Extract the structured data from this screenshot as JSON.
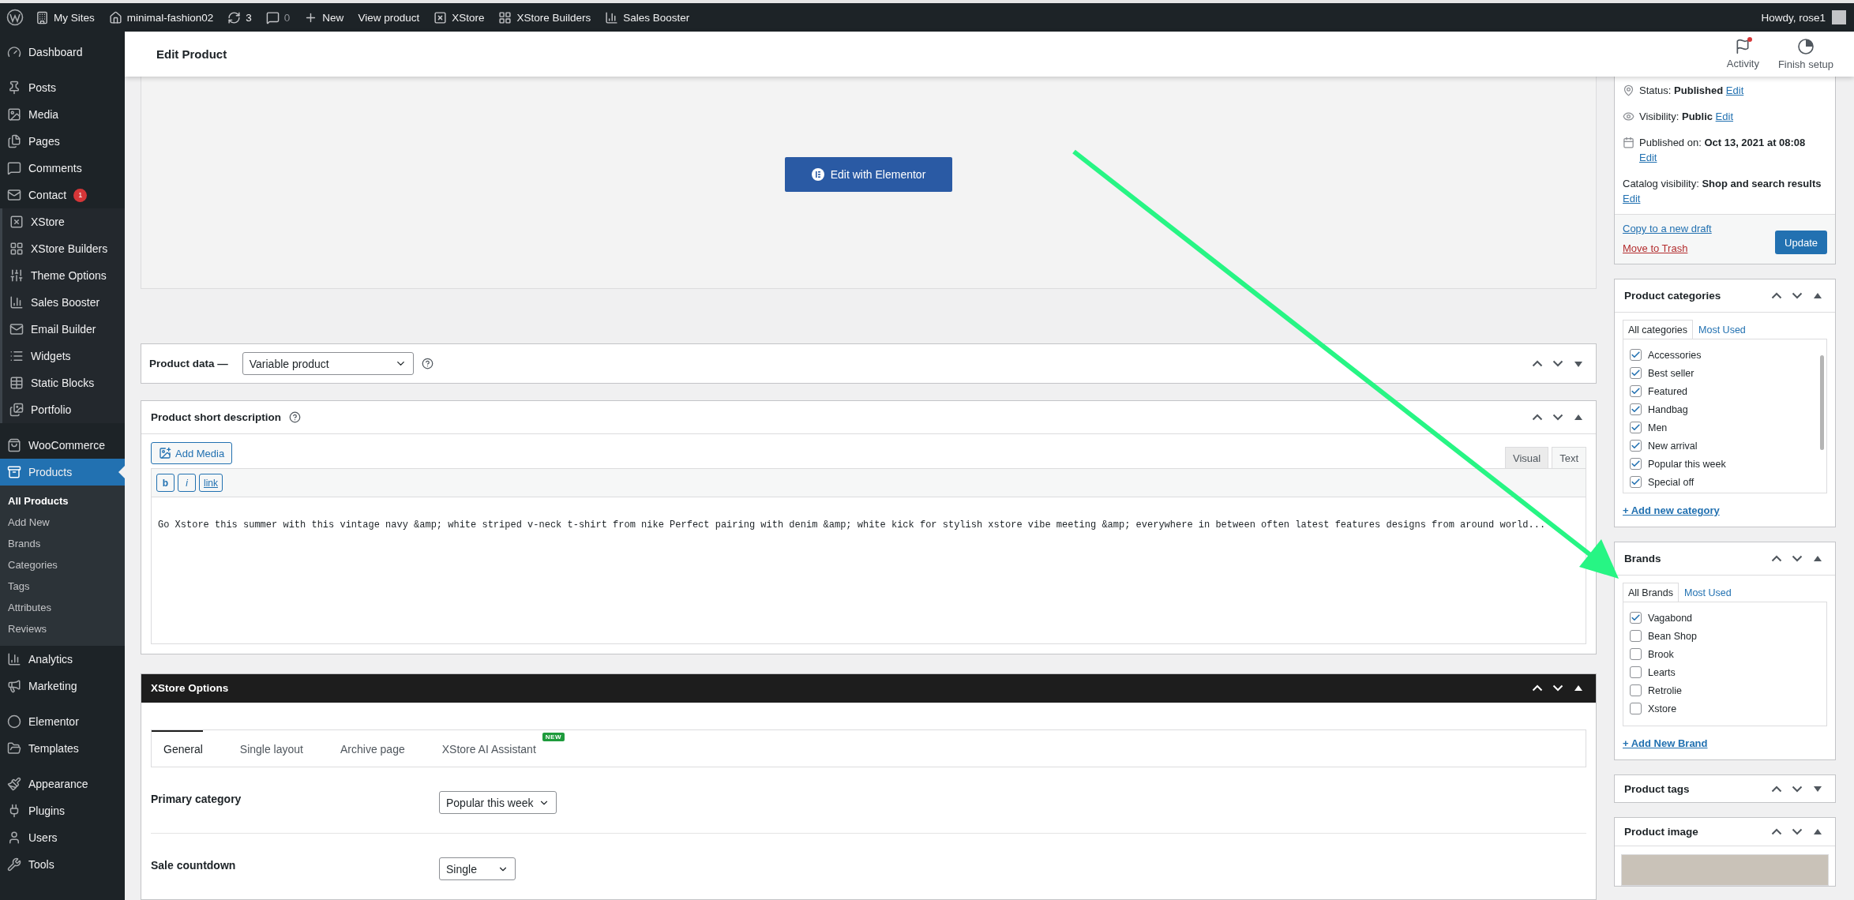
{
  "admin_bar": {
    "items": [
      "My Sites",
      "minimal-fashion02",
      "3",
      "0",
      "New",
      "View product",
      "XStore",
      "XStore Builders",
      "Sales Booster"
    ],
    "greeting": "Howdy, rose1"
  },
  "sidebar": {
    "sections": [
      {
        "kind": "plain",
        "items": [
          {
            "label": "Dashboard",
            "selected": false
          }
        ]
      },
      {
        "kind": "plain",
        "items": [
          {
            "label": "Posts",
            "selected": false
          },
          {
            "label": "Media",
            "selected": false
          },
          {
            "label": "Pages",
            "selected": false
          },
          {
            "label": "Comments",
            "selected": false
          },
          {
            "label": "Contact",
            "selected": false,
            "badge": "1"
          }
        ]
      },
      {
        "kind": "theme",
        "items": [
          {
            "label": "XStore",
            "selected": false
          },
          {
            "label": "XStore Builders",
            "selected": false
          },
          {
            "label": "Theme Options",
            "selected": false
          },
          {
            "label": "Sales Booster",
            "selected": false
          },
          {
            "label": "Email Builder",
            "selected": false
          },
          {
            "label": "Widgets",
            "selected": false
          },
          {
            "label": "Static Blocks",
            "selected": false
          },
          {
            "label": "Portfolio",
            "selected": false
          }
        ]
      },
      {
        "kind": "plain",
        "items": [
          {
            "label": "WooCommerce",
            "selected": false
          },
          {
            "label": "Products",
            "selected": true,
            "submenu": [
              {
                "label": "All Products",
                "selected": true
              },
              {
                "label": "Add New",
                "selected": false
              },
              {
                "label": "Brands",
                "selected": false
              },
              {
                "label": "Categories",
                "selected": false
              },
              {
                "label": "Tags",
                "selected": false
              },
              {
                "label": "Attributes",
                "selected": false
              },
              {
                "label": "Reviews",
                "selected": false
              }
            ]
          },
          {
            "label": "Analytics",
            "selected": false
          },
          {
            "label": "Marketing",
            "selected": false
          }
        ]
      },
      {
        "kind": "plain",
        "items": [
          {
            "label": "Elementor",
            "selected": false
          },
          {
            "label": "Templates",
            "selected": false
          }
        ]
      },
      {
        "kind": "plain",
        "items": [
          {
            "label": "Appearance",
            "selected": false
          },
          {
            "label": "Plugins",
            "selected": false
          },
          {
            "label": "Users",
            "selected": false
          },
          {
            "label": "Tools",
            "selected": false
          }
        ]
      }
    ]
  },
  "header": {
    "title": "Edit Product",
    "actions": [
      "Activity",
      "Finish setup"
    ]
  },
  "elementor": {
    "button": "Edit with Elementor"
  },
  "product_data": {
    "label": "Product data —",
    "type": "Variable product",
    "expanded": false
  },
  "short_description": {
    "title": "Product short description",
    "expanded": true,
    "add_media": "Add Media",
    "editor_tabs": [
      {
        "label": "Visual",
        "selected": false
      },
      {
        "label": "Text",
        "selected": true
      }
    ],
    "quicktags": [
      "b",
      "i",
      "link"
    ],
    "content": "Go Xstore this summer with this vintage navy &amp; white striped v-neck t-shirt from nike Perfect pairing with denim &amp; white kick for stylish xstore vibe meeting &amp; everywhere in between often latest features designs from around world..."
  },
  "xstore_options": {
    "title": "XStore Options",
    "expanded": true,
    "tabs": [
      {
        "label": "General",
        "selected": true
      },
      {
        "label": "Single layout",
        "selected": false
      },
      {
        "label": "Archive page",
        "selected": false
      },
      {
        "label": "XStore AI Assistant",
        "selected": false,
        "badge": "NEW"
      }
    ],
    "fields": [
      {
        "label": "Primary category",
        "value": "Popular this week"
      },
      {
        "label": "Sale countdown",
        "value": "Single"
      }
    ]
  },
  "publish": {
    "rows": [
      {
        "label": "Status:",
        "value": "Published",
        "link": "Edit"
      },
      {
        "label": "Visibility:",
        "value": "Public",
        "link": "Edit"
      },
      {
        "label": "Published on:",
        "value": "Oct 13, 2021 at 08:08",
        "link": "Edit"
      },
      {
        "label": "Catalog visibility:",
        "value": "Shop and search results",
        "link": "Edit"
      }
    ],
    "copy_link": "Copy to a new draft",
    "trash_link": "Move to Trash",
    "update": "Update"
  },
  "categories": {
    "title": "Product categories",
    "expanded": true,
    "tabs": [
      {
        "label": "All categories",
        "selected": true
      },
      {
        "label": "Most Used",
        "selected": false
      }
    ],
    "items": [
      {
        "label": "Accessories",
        "checked": true
      },
      {
        "label": "Best seller",
        "checked": true
      },
      {
        "label": "Featured",
        "checked": true
      },
      {
        "label": "Handbag",
        "checked": true
      },
      {
        "label": "Men",
        "checked": true
      },
      {
        "label": "New arrival",
        "checked": true
      },
      {
        "label": "Popular this week",
        "checked": true
      },
      {
        "label": "Special off",
        "checked": true
      }
    ],
    "add_link": "+ Add new category"
  },
  "brands": {
    "title": "Brands",
    "expanded": true,
    "tabs": [
      {
        "label": "All Brands",
        "selected": true
      },
      {
        "label": "Most Used",
        "selected": false
      }
    ],
    "items": [
      {
        "label": "Vagabond",
        "checked": true
      },
      {
        "label": "Bean Shop",
        "checked": false
      },
      {
        "label": "Brook",
        "checked": false
      },
      {
        "label": "Learts",
        "checked": false
      },
      {
        "label": "Retrolie",
        "checked": false
      },
      {
        "label": "Xstore",
        "checked": false
      }
    ],
    "add_link": "+ Add New Brand"
  },
  "tags": {
    "title": "Product tags",
    "expanded": false
  },
  "image": {
    "title": "Product image",
    "expanded": true
  }
}
